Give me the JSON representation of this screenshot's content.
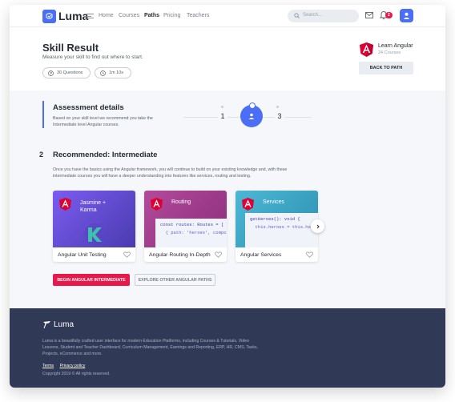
{
  "nav": {
    "brand": "Luma",
    "links": [
      "Home",
      "Courses",
      "Paths",
      "Pricing",
      "Teachers"
    ],
    "active_link": "Paths",
    "search_placeholder": "Search...",
    "notification_count": "2"
  },
  "header": {
    "title": "Skill Result",
    "subtitle": "Measure your skill to find out where to start.",
    "questions": "30 Questions",
    "duration": "1m 10s",
    "course_name": "Learn Angular",
    "course_count": "24 Courses",
    "back_button": "BACK TO PATH"
  },
  "assessment": {
    "title": "Assessment details",
    "description": "Based on your skill level we recommend you take the Intermediate level Angular courses.",
    "steps": [
      "1",
      "3"
    ]
  },
  "recommended": {
    "number": "2",
    "title": "Recommended: Intermediate",
    "description": "Once you have the basics using the Angular framework, you will continue to build on your existing knowledge and, with these intermediate courses you will have a deeper understanding into features like services, routing and testing.",
    "cards": [
      {
        "image_title": "Jasmine + Karma",
        "label": "Angular Unit Testing",
        "color": "#6a4fd6"
      },
      {
        "image_title": "Routing",
        "label": "Angular Routing In-Depth",
        "color": "#a23a8f"
      },
      {
        "image_title": "Services",
        "label": "Angular Services",
        "color": "#3aa5c7"
      }
    ],
    "code_routing": [
      "const routes: Routes = [",
      "  { path: 'heroes', compo"
    ],
    "code_services": [
      "getHeroes(): void {",
      "  this.heroes = this.her"
    ],
    "begin_button": "BEGIN ANGULAR INTERMEDIATE",
    "explore_button": "EXPLORE OTHER ANGULAR PATHS"
  },
  "footer": {
    "brand": "Luma",
    "description": "Luma is a beautifully crafted user interface for modern Education Platforms, including Courses & Tutorials, Video Lessons, Student and Teacher Dashboard, Curriculum Management, Earnings and Reporting, ERP, HR, CMS, Tasks, Projects, eCommerce and more.",
    "terms": "Terms",
    "privacy": "Privacy policy",
    "copyright": "Copyright 2019 © All rights reserved."
  },
  "colors": {
    "accent": "#4a6ef5",
    "primary_button": "#e8194a",
    "footer_bg": "#303956",
    "angular_red": "#dd0031"
  }
}
